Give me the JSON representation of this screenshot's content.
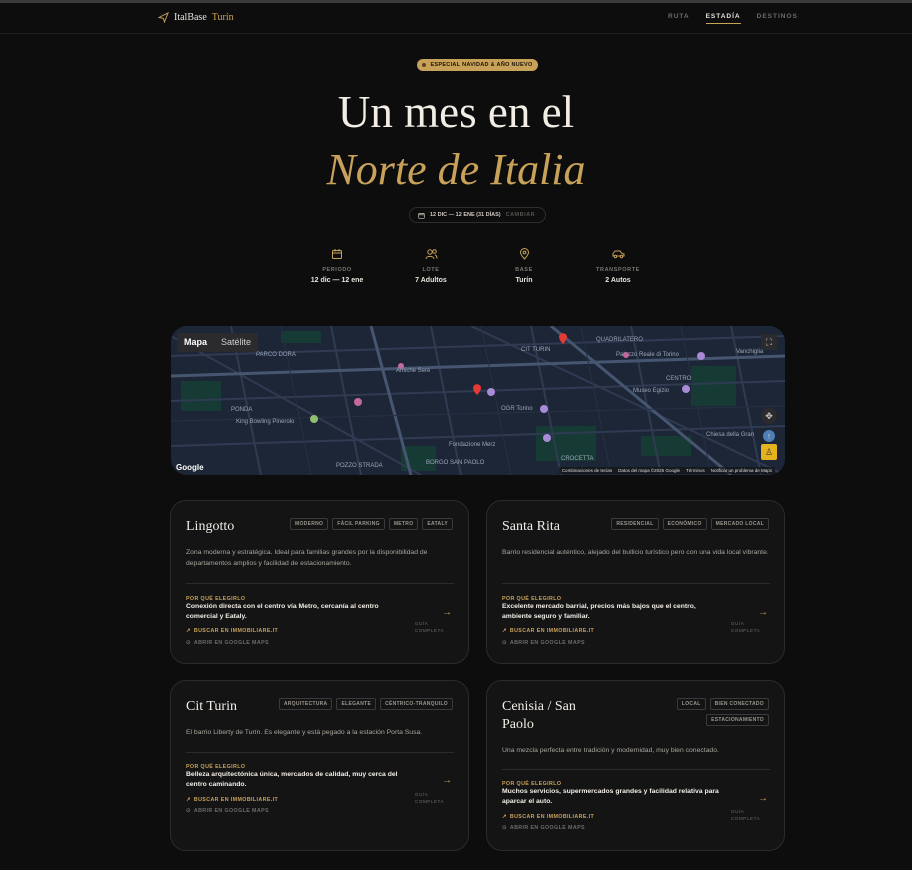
{
  "nav": {
    "brand_main": "ItalBase",
    "brand_accent": "Turín",
    "links": [
      "RUTA",
      "ESTADÍA",
      "DESTINOS"
    ]
  },
  "hero": {
    "badge": "ESPECIAL NAVIDAD & AÑO NUEVO",
    "title_line1": "Un mes en el",
    "title_line2": "Norte de Italia",
    "dates": "12 DIC — 12 ENE (31 DÍAS)",
    "change": "CAMBIAR"
  },
  "stats": [
    {
      "icon": "calendar-icon",
      "label": "PERIODO",
      "value": "12 dic — 12 ene"
    },
    {
      "icon": "users-icon",
      "label": "LOTE",
      "value": "7 Adultos"
    },
    {
      "icon": "map-pin-icon",
      "label": "BASE",
      "value": "Turín"
    },
    {
      "icon": "car-icon",
      "label": "TRANSPORTE",
      "value": "2 Autos"
    }
  ],
  "map": {
    "type_map": "Mapa",
    "type_satellite": "Satélite",
    "google": "Google",
    "labels": [
      "PARCO DORA",
      "CIT TURIN",
      "QUADRILATERO",
      "Palazzo Reale di Torino",
      "VANCHIGLIA",
      "BARRIERA DI MILANO",
      "CENTRO",
      "Museo Egizio",
      "Chiesa della Gran Madre di Dio",
      "POZZO STRADA",
      "BORGO SAN PAOLO",
      "CROCETTA",
      "Fondazione Merz",
      "OGR Torino",
      "King Bowling Pinerolo",
      "Antiche Sere",
      "PARELLA",
      "CAMPIDOGLIO",
      "POZZA"
    ],
    "attribution": [
      "Combinaciones de teclas",
      "Datos del mapa ©2026 Google",
      "Términos",
      "Notificar un problema de Maps"
    ]
  },
  "cards": [
    {
      "title": "Lingotto",
      "tags": [
        "MODERNO",
        "FÁCIL PARKING",
        "METRO",
        "EATALY"
      ],
      "desc": "Zona moderna y estratégica. Ideal para familias grandes por la disponibilidad de departamentos amplios y facilidad de estacionamiento.",
      "why_label": "POR QUÉ ELEGIRLO",
      "why": "Conexión directa con el centro vía Metro, cercanía al centro comercial y Eataly.",
      "search": "BUSCAR EN IMMOBILIARE.IT",
      "maps": "ABRIR EN GOOGLE MAPS",
      "guide": "GUÍA COMPLETA"
    },
    {
      "title": "Santa Rita",
      "tags": [
        "RESIDENCIAL",
        "ECONÓMICO",
        "MERCADO LOCAL"
      ],
      "desc": "Barrio residencial auténtico, alejado del bullicio turístico pero con una vida local vibrante.",
      "why_label": "POR QUÉ ELEGIRLO",
      "why": "Excelente mercado barrial, precios más bajos que el centro, ambiente seguro y familiar.",
      "search": "BUSCAR EN IMMOBILIARE.IT",
      "maps": "ABRIR EN GOOGLE MAPS",
      "guide": "GUÍA COMPLETA"
    },
    {
      "title": "Cit Turin",
      "tags": [
        "ARQUITECTURA",
        "ELEGANTE",
        "CÉNTRICO-TRANQUILO"
      ],
      "desc": "El barrio Liberty de Turín. Es elegante y está pegado a la estación Porta Susa.",
      "why_label": "POR QUÉ ELEGIRLO",
      "why": "Belleza arquitectónica única, mercados de calidad, muy cerca del centro caminando.",
      "search": "BUSCAR EN IMMOBILIARE.IT",
      "maps": "ABRIR EN GOOGLE MAPS",
      "guide": "GUÍA COMPLETA"
    },
    {
      "title": "Cenisia / San Paolo",
      "tags": [
        "LOCAL",
        "BIEN CONECTADO",
        "ESTACIONAMIENTO"
      ],
      "desc": "Una mezcla perfecta entre tradición y modernidad, muy bien conectado.",
      "why_label": "POR QUÉ ELEGIRLO",
      "why": "Muchos servicios, supermercados grandes y facilidad relativa para aparcar el auto.",
      "search": "BUSCAR EN IMMOBILIARE.IT",
      "maps": "ABRIR EN GOOGLE MAPS",
      "guide": "GUÍA COMPLETA"
    }
  ]
}
